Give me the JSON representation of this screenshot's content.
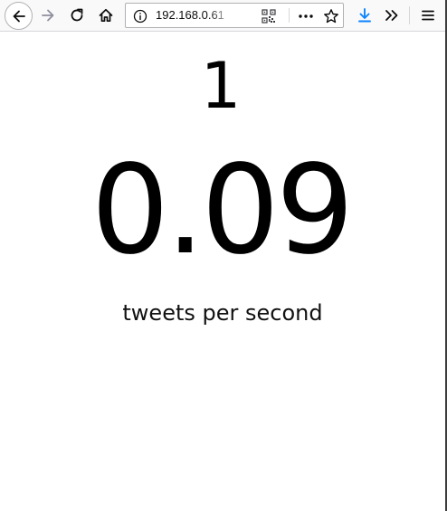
{
  "browser": {
    "url": "192.168.0.61",
    "icons": {
      "back": "back-arrow-icon",
      "forward": "forward-arrow-icon",
      "reload": "reload-icon",
      "home": "home-icon",
      "info": "info-icon",
      "qr": "qr-code-icon",
      "page_actions": "more-icon",
      "bookmark": "star-icon",
      "download": "download-icon",
      "overflow": "overflow-icon",
      "menu": "hamburger-menu-icon"
    },
    "colors": {
      "toolbar_bg": "#f9f9fa",
      "download_accent": "#0a84ff"
    }
  },
  "page": {
    "count": "1",
    "rate": "0.09",
    "rate_label": "tweets per second"
  }
}
